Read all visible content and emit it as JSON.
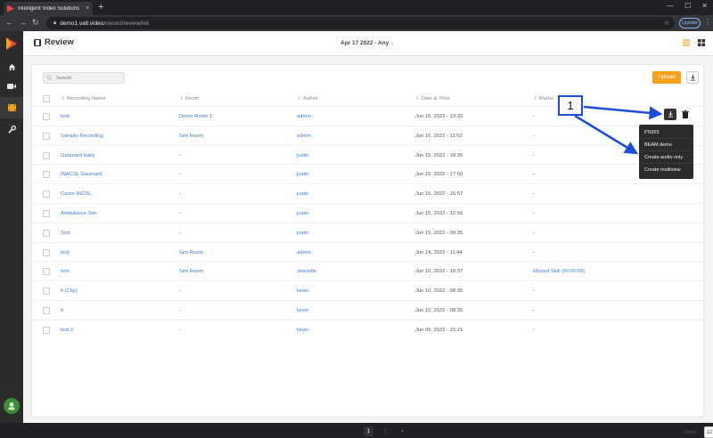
{
  "browser": {
    "tab_title": "Intelligent Video Solutions",
    "tab_close": "×",
    "new_tab": "+",
    "url_host": "demo1.valt.video",
    "url_path": "/record/review/list",
    "update_label": "Update",
    "back": "←",
    "forward": "→",
    "reload": "↻",
    "minimize": "—",
    "maximize": "☐",
    "close": "✕",
    "star": "☆",
    "menu": "⋮"
  },
  "header": {
    "title": "Review",
    "date_filter": "Apr 17 2022 - Any"
  },
  "toolbar": {
    "search_placeholder": "Search",
    "upload_label": "Upload"
  },
  "table": {
    "columns": [
      "Recording Name",
      "Room",
      "Author",
      "Date & Time",
      "Marke"
    ],
    "rows": [
      {
        "name": "test",
        "room": "Demo Room 1",
        "author": "admin",
        "date": "Jun 16, 2022 - 13:32",
        "marker": "-"
      },
      {
        "name": "Sample Recording",
        "room": "Sim Room",
        "author": "admin",
        "date": "Jun 16, 2022 - 11:52",
        "marker": "-"
      },
      {
        "name": "Gaumard baby",
        "room": "-",
        "author": "justin",
        "date": "Jun 15, 2022 - 18:35",
        "marker": "-"
      },
      {
        "name": "INACSL Gaumard",
        "room": "-",
        "author": "justin",
        "date": "Jun 15, 2022 - 17:50",
        "marker": "-"
      },
      {
        "name": "Carrie INCSL",
        "room": "-",
        "author": "justin",
        "date": "Jun 15, 2022 - 16:57",
        "marker": "-"
      },
      {
        "name": "Ambulance Sim",
        "room": "-",
        "author": "justin",
        "date": "Jun 15, 2022 - 12:56",
        "marker": "-"
      },
      {
        "name": "Test",
        "room": "-",
        "author": "justin",
        "date": "Jun 15, 2022 - 09:35",
        "marker": "-"
      },
      {
        "name": "test",
        "room": "Sim Room",
        "author": "admin",
        "date": "Jun 14, 2022 - 11:44",
        "marker": "-"
      },
      {
        "name": "test",
        "room": "Sim Room",
        "author": "Jeanette",
        "date": "Jun 10, 2022 - 10:37",
        "marker": "Missed Skill (00:00:06)"
      },
      {
        "name": "h (Clip)",
        "room": "-",
        "author": "kevin",
        "date": "Jun 10, 2022 - 08:35",
        "marker": "-"
      },
      {
        "name": "h",
        "room": "-",
        "author": "kevin",
        "date": "Jun 10, 2022 - 08:35",
        "marker": "-"
      },
      {
        "name": "test 2",
        "room": "-",
        "author": "kevin",
        "date": "Jun 09, 2022 - 15:21",
        "marker": "-"
      }
    ]
  },
  "download_menu": {
    "items": [
      "PS655",
      "BEAM demo",
      "Create audio only",
      "Create multiview"
    ]
  },
  "annotation": {
    "label": "1",
    "color": "#1c4fd8"
  },
  "pagination": {
    "pages": [
      "1",
      "2"
    ],
    "next": "›",
    "view_label": "View:",
    "page_size": "12"
  },
  "colors": {
    "accent": "#f5a21b",
    "link": "#3b7dd8",
    "sidebar": "#2b2b2b"
  }
}
